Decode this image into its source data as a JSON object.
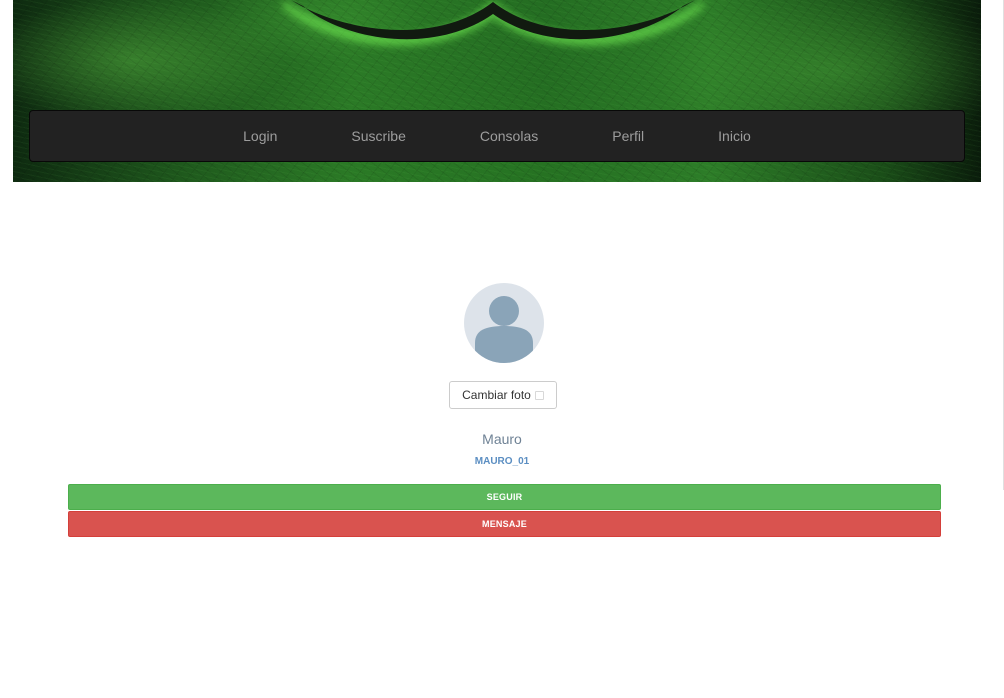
{
  "header": {
    "nav": [
      {
        "label": "Login"
      },
      {
        "label": "Suscribe"
      },
      {
        "label": "Consolas"
      },
      {
        "label": "Perfil"
      },
      {
        "label": "Inicio"
      }
    ]
  },
  "profile": {
    "change_photo_label": "Cambiar foto",
    "name": "Mauro",
    "username": "MAURO_01",
    "follow_label": "SEGUIR",
    "message_label": "MENSAJE"
  },
  "colors": {
    "navbar_bg": "#222222",
    "nav_text": "#9d9d9d",
    "follow_button": "#5cb85c",
    "message_button": "#d9534f",
    "username_link": "#5b8ec2"
  }
}
